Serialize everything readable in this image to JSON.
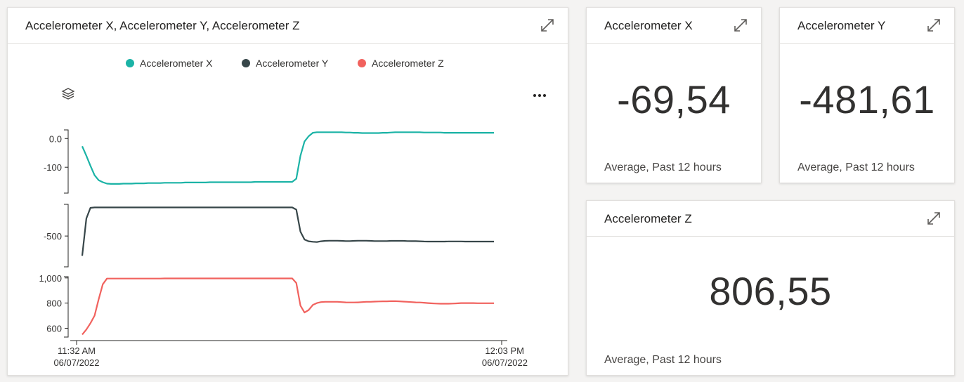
{
  "main_chart_tile": {
    "title": "Accelerometer X, Accelerometer Y, Accelerometer Z",
    "legend": [
      {
        "label": "Accelerometer X",
        "color": "#1bb3a6"
      },
      {
        "label": "Accelerometer Y",
        "color": "#374649"
      },
      {
        "label": "Accelerometer Z",
        "color": "#f1625e"
      }
    ],
    "icons": {
      "expand": "expand-icon",
      "layers": "layers-icon",
      "more": "more-options-icon"
    }
  },
  "chart_data": {
    "type": "line",
    "x_start_label": [
      "11:32 AM",
      "06/07/2022"
    ],
    "x_end_label": [
      "12:03 PM",
      "06/07/2022"
    ],
    "x": [
      0,
      1,
      2,
      3,
      4,
      5,
      6,
      7,
      8,
      9,
      10,
      11,
      12,
      13,
      14,
      15,
      16,
      17,
      18,
      19,
      20,
      21,
      22,
      23,
      24,
      25,
      26,
      27,
      28,
      29,
      30,
      31,
      32,
      33,
      34,
      35,
      36,
      37,
      38,
      39,
      40,
      41,
      42,
      43,
      44,
      45,
      46,
      47,
      48,
      49,
      50,
      51,
      52,
      53,
      54,
      55,
      56,
      57,
      58,
      59,
      60,
      61,
      62,
      63,
      64,
      65,
      66,
      67,
      68,
      69,
      70,
      71,
      72,
      73,
      74,
      75,
      76,
      77,
      78,
      79,
      80,
      81,
      82,
      83,
      84,
      85,
      86,
      87,
      88,
      89,
      90,
      91,
      92,
      93,
      94,
      95,
      96,
      97,
      98,
      99,
      100
    ],
    "panels": [
      {
        "series": "Accelerometer X",
        "color": "#1bb3a6",
        "ticks": [
          0.0,
          -100
        ],
        "tick_labels": [
          "0.0",
          "-100"
        ],
        "ylim": [
          -190,
          30
        ],
        "values": [
          -27,
          -60,
          -95,
          -128,
          -145,
          -152,
          -157,
          -158,
          -158,
          -158,
          -157,
          -157,
          -157,
          -156,
          -156,
          -156,
          -155,
          -155,
          -155,
          -155,
          -154,
          -154,
          -154,
          -154,
          -154,
          -153,
          -153,
          -153,
          -153,
          -153,
          -153,
          -152,
          -152,
          -152,
          -152,
          -152,
          -152,
          -152,
          -152,
          -152,
          -152,
          -152,
          -151,
          -151,
          -151,
          -151,
          -151,
          -151,
          -151,
          -151,
          -151,
          -151,
          -140,
          -60,
          -10,
          8,
          20,
          22,
          22,
          22,
          22,
          22,
          22,
          22,
          21,
          21,
          20,
          20,
          19,
          19,
          19,
          19,
          19,
          20,
          20,
          21,
          22,
          22,
          22,
          22,
          22,
          22,
          22,
          21,
          21,
          21,
          21,
          21,
          20,
          20,
          20,
          20,
          20,
          20,
          20,
          20,
          20,
          20,
          20,
          20,
          20
        ]
      },
      {
        "series": "Accelerometer Y",
        "color": "#374649",
        "ticks": [
          -500
        ],
        "tick_labels": [
          "-500"
        ],
        "ylim": [
          -850,
          -140
        ],
        "values": [
          -725,
          -300,
          -180,
          -175,
          -175,
          -175,
          -175,
          -175,
          -175,
          -175,
          -175,
          -175,
          -175,
          -175,
          -175,
          -175,
          -175,
          -175,
          -175,
          -175,
          -175,
          -175,
          -175,
          -175,
          -175,
          -175,
          -175,
          -175,
          -175,
          -175,
          -175,
          -175,
          -175,
          -175,
          -175,
          -175,
          -175,
          -175,
          -175,
          -175,
          -175,
          -175,
          -175,
          -175,
          -175,
          -175,
          -175,
          -175,
          -175,
          -175,
          -175,
          -175,
          -200,
          -450,
          -540,
          -560,
          -565,
          -568,
          -560,
          -555,
          -553,
          -553,
          -553,
          -555,
          -557,
          -557,
          -555,
          -553,
          -553,
          -553,
          -555,
          -557,
          -557,
          -557,
          -557,
          -555,
          -555,
          -555,
          -555,
          -557,
          -558,
          -558,
          -560,
          -562,
          -563,
          -563,
          -563,
          -563,
          -563,
          -561,
          -561,
          -561,
          -561,
          -563,
          -563,
          -563,
          -563,
          -563,
          -563,
          -563,
          -563
        ]
      },
      {
        "series": "Accelerometer Z",
        "color": "#f1625e",
        "ticks": [
          1000,
          800,
          600
        ],
        "tick_labels": [
          "1,000",
          "800",
          "600"
        ],
        "ylim": [
          530,
          1010
        ],
        "values": [
          550,
          590,
          640,
          700,
          830,
          950,
          995,
          995,
          995,
          995,
          995,
          995,
          995,
          995,
          995,
          995,
          995,
          995,
          995,
          995,
          996,
          996,
          996,
          996,
          996,
          996,
          996,
          996,
          996,
          996,
          996,
          996,
          996,
          996,
          996,
          996,
          996,
          996,
          996,
          996,
          996,
          996,
          996,
          996,
          996,
          996,
          996,
          996,
          996,
          996,
          996,
          996,
          960,
          780,
          725,
          745,
          785,
          800,
          808,
          810,
          810,
          810,
          810,
          808,
          806,
          805,
          805,
          806,
          808,
          810,
          810,
          812,
          813,
          814,
          814,
          815,
          815,
          814,
          812,
          810,
          808,
          806,
          805,
          803,
          800,
          798,
          796,
          795,
          795,
          795,
          796,
          798,
          800,
          800,
          800,
          800,
          799,
          799,
          799,
          799,
          799
        ]
      }
    ]
  },
  "tiles": [
    {
      "title": "Accelerometer X",
      "value": "-69,54",
      "footer": "Average, Past 12 hours"
    },
    {
      "title": "Accelerometer Y",
      "value": "-481,61",
      "footer": "Average, Past 12 hours"
    },
    {
      "title": "Accelerometer Z",
      "value": "806,55",
      "footer": "Average, Past 12 hours"
    }
  ]
}
